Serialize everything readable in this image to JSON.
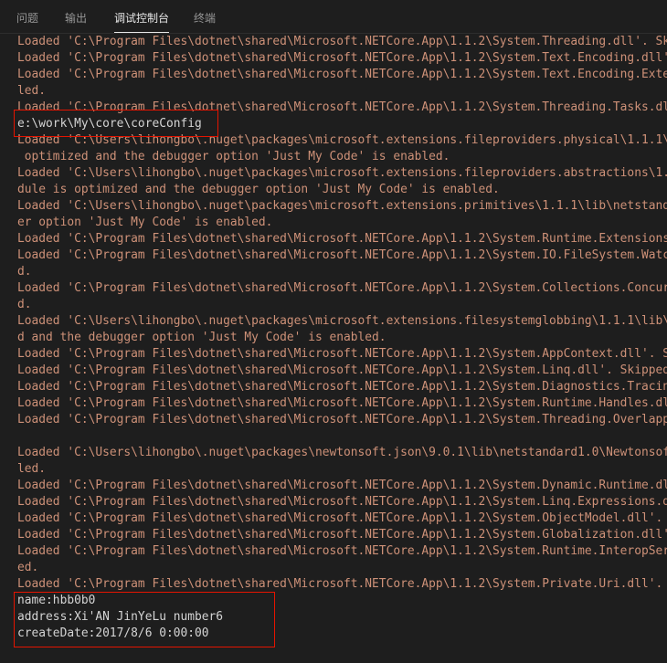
{
  "tabs": [
    {
      "label": "问题",
      "active": false
    },
    {
      "label": "输出",
      "active": false
    },
    {
      "label": "调试控制台",
      "active": true
    },
    {
      "label": "终端",
      "active": false
    }
  ],
  "console": {
    "lines": [
      {
        "text": "Loaded 'C:\\Program Files\\dotnet\\shared\\Microsoft.NETCore.App\\1.1.2\\System.Threading.dll'. Ski",
        "kind": "log"
      },
      {
        "text": "Loaded 'C:\\Program Files\\dotnet\\shared\\Microsoft.NETCore.App\\1.1.2\\System.Text.Encoding.dll'.",
        "kind": "log"
      },
      {
        "text": "Loaded 'C:\\Program Files\\dotnet\\shared\\Microsoft.NETCore.App\\1.1.2\\System.Text.Encoding.Exte",
        "kind": "log"
      },
      {
        "text": "led.",
        "kind": "log"
      },
      {
        "text": "Loaded 'C:\\Program Files\\dotnet\\shared\\Microsoft.NETCore.App\\1.1.2\\System.Threading.Tasks.dll",
        "kind": "log"
      },
      {
        "text": "e:\\work\\My\\core\\coreConfig",
        "kind": "output"
      },
      {
        "text": "Loaded 'C:\\Users\\lihongbo\\.nuget\\packages\\microsoft.extensions.fileproviders.physical\\1.1.1\\l",
        "kind": "log"
      },
      {
        "text": " optimized and the debugger option 'Just My Code' is enabled.",
        "kind": "log"
      },
      {
        "text": "Loaded 'C:\\Users\\lihongbo\\.nuget\\packages\\microsoft.extensions.fileproviders.abstractions\\1.1",
        "kind": "log"
      },
      {
        "text": "dule is optimized and the debugger option 'Just My Code' is enabled.",
        "kind": "log"
      },
      {
        "text": "Loaded 'C:\\Users\\lihongbo\\.nuget\\packages\\microsoft.extensions.primitives\\1.1.1\\lib\\netstanda",
        "kind": "log"
      },
      {
        "text": "er option 'Just My Code' is enabled.",
        "kind": "log"
      },
      {
        "text": "Loaded 'C:\\Program Files\\dotnet\\shared\\Microsoft.NETCore.App\\1.1.2\\System.Runtime.Extensions.",
        "kind": "log"
      },
      {
        "text": "Loaded 'C:\\Program Files\\dotnet\\shared\\Microsoft.NETCore.App\\1.1.2\\System.IO.FileSystem.Watch",
        "kind": "log"
      },
      {
        "text": "d.",
        "kind": "log"
      },
      {
        "text": "Loaded 'C:\\Program Files\\dotnet\\shared\\Microsoft.NETCore.App\\1.1.2\\System.Collections.Concurr",
        "kind": "log"
      },
      {
        "text": "d.",
        "kind": "log"
      },
      {
        "text": "Loaded 'C:\\Users\\lihongbo\\.nuget\\packages\\microsoft.extensions.filesystemglobbing\\1.1.1\\lib\\n",
        "kind": "log"
      },
      {
        "text": "d and the debugger option 'Just My Code' is enabled.",
        "kind": "log"
      },
      {
        "text": "Loaded 'C:\\Program Files\\dotnet\\shared\\Microsoft.NETCore.App\\1.1.2\\System.AppContext.dll'. Sk",
        "kind": "log"
      },
      {
        "text": "Loaded 'C:\\Program Files\\dotnet\\shared\\Microsoft.NETCore.App\\1.1.2\\System.Linq.dll'. Skipped",
        "kind": "log"
      },
      {
        "text": "Loaded 'C:\\Program Files\\dotnet\\shared\\Microsoft.NETCore.App\\1.1.2\\System.Diagnostics.Tracing",
        "kind": "log"
      },
      {
        "text": "Loaded 'C:\\Program Files\\dotnet\\shared\\Microsoft.NETCore.App\\1.1.2\\System.Runtime.Handles.dll",
        "kind": "log"
      },
      {
        "text": "Loaded 'C:\\Program Files\\dotnet\\shared\\Microsoft.NETCore.App\\1.1.2\\System.Threading.Overlappe",
        "kind": "log"
      },
      {
        "text": "",
        "kind": "log"
      },
      {
        "text": "Loaded 'C:\\Users\\lihongbo\\.nuget\\packages\\newtonsoft.json\\9.0.1\\lib\\netstandard1.0\\Newtonsoft",
        "kind": "log"
      },
      {
        "text": "led.",
        "kind": "log"
      },
      {
        "text": "Loaded 'C:\\Program Files\\dotnet\\shared\\Microsoft.NETCore.App\\1.1.2\\System.Dynamic.Runtime.dll",
        "kind": "log"
      },
      {
        "text": "Loaded 'C:\\Program Files\\dotnet\\shared\\Microsoft.NETCore.App\\1.1.2\\System.Linq.Expressions.dl",
        "kind": "log"
      },
      {
        "text": "Loaded 'C:\\Program Files\\dotnet\\shared\\Microsoft.NETCore.App\\1.1.2\\System.ObjectModel.dll'. S",
        "kind": "log"
      },
      {
        "text": "Loaded 'C:\\Program Files\\dotnet\\shared\\Microsoft.NETCore.App\\1.1.2\\System.Globalization.dll'.",
        "kind": "log"
      },
      {
        "text": "Loaded 'C:\\Program Files\\dotnet\\shared\\Microsoft.NETCore.App\\1.1.2\\System.Runtime.InteropServ",
        "kind": "log"
      },
      {
        "text": "ed.",
        "kind": "log"
      },
      {
        "text": "Loaded 'C:\\Program Files\\dotnet\\shared\\Microsoft.NETCore.App\\1.1.2\\System.Private.Uri.dll'. S",
        "kind": "log"
      },
      {
        "text": "name:hbb0b0",
        "kind": "output"
      },
      {
        "text": "address:Xi'AN JinYeLu number6",
        "kind": "output"
      },
      {
        "text": "createDate:2017/8/6 0:00:00",
        "kind": "output"
      }
    ]
  },
  "colors": {
    "background": "#1e1e1e",
    "log_text": "#ce9178",
    "output_text": "#d4d4d4",
    "highlight_border": "#e51400",
    "tab_inactive": "#969696",
    "tab_active": "#e7e7e7"
  }
}
